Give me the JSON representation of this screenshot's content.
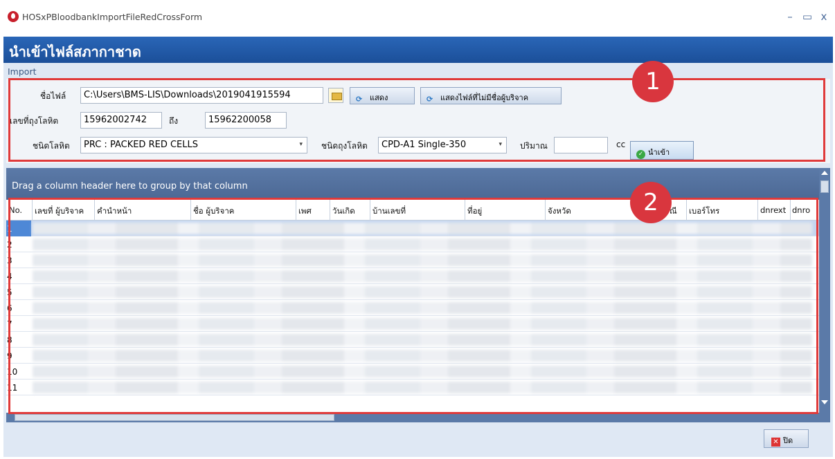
{
  "window": {
    "title": "HOSxPBloodbankImportFileRedCrossForm",
    "controls": [
      "–",
      "▭",
      "x"
    ]
  },
  "header": {
    "title": "นำเข้าไฟล์สภากาชาด"
  },
  "import": {
    "group_label": "Import",
    "file_label": "ชื่อไฟล์",
    "file_value": "C:\\Users\\BMS-LIS\\Downloads\\2019041915594",
    "show_button": "แสดง",
    "show_unmatched_button": "แสดงไฟล์ที่ไม่มีชื่อผู้บริจาค",
    "bag_no_label": "เลขที่ถุงโลหิต",
    "bag_no_from": "15962002742",
    "to_label": "ถึง",
    "bag_no_to": "15962200058",
    "blood_type_label": "ชนิดโลหิต",
    "blood_type_value": "PRC : PACKED RED CELLS",
    "bag_type_label": "ชนิดถุงโลหิต",
    "bag_type_value": "CPD-A1 Single-350",
    "volume_label": "ปริมาณ",
    "volume_value": "",
    "unit_label": "cc",
    "import_button": "นำเข้า"
  },
  "annotations": {
    "badge1": "1",
    "badge2": "2"
  },
  "grid": {
    "group_hint": "Drag a column header here to group by that column",
    "columns": [
      "No.",
      "เลขที่ ผู้บริจาค",
      "คำนำหน้า",
      "ชื่อ ผู้บริจาค",
      "เพศ",
      "วันเกิด",
      "บ้านเลขที่",
      "ที่อยู่",
      "จังหวัด",
      "ณี",
      "เบอร์โทร",
      "dnrext",
      "dnro"
    ],
    "row_numbers": [
      "1",
      "2",
      "3",
      "4",
      "5",
      "6",
      "7",
      "8",
      "9",
      "10",
      "11"
    ],
    "selected_row": "1"
  },
  "footer": {
    "close_button": "ปิด"
  },
  "icons": {
    "app": "blood-drop-icon",
    "browse": "folder-icon",
    "refresh": "refresh-icon",
    "ok": "check-circle-icon",
    "close": "close-icon"
  },
  "colors": {
    "accent": "#1b4f99",
    "annotation_red": "#e03a3a",
    "grid_bar": "#5b7aa8"
  }
}
